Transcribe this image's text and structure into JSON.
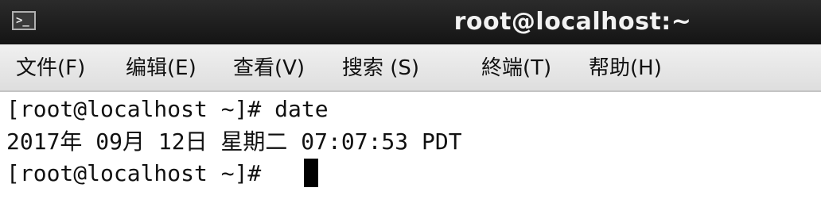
{
  "titlebar": {
    "icon": "terminal-icon",
    "title": "root@localhost:~"
  },
  "menu": {
    "items": [
      "文件(F)",
      "编辑(E)",
      "查看(V)",
      "搜索 (S)",
      "終端(T)",
      "帮助(H)"
    ]
  },
  "terminal": {
    "lines": [
      "[root@localhost ~]# date",
      "2017年 09月 12日 星期二 07:07:53 PDT",
      "[root@localhost ~]# "
    ]
  }
}
